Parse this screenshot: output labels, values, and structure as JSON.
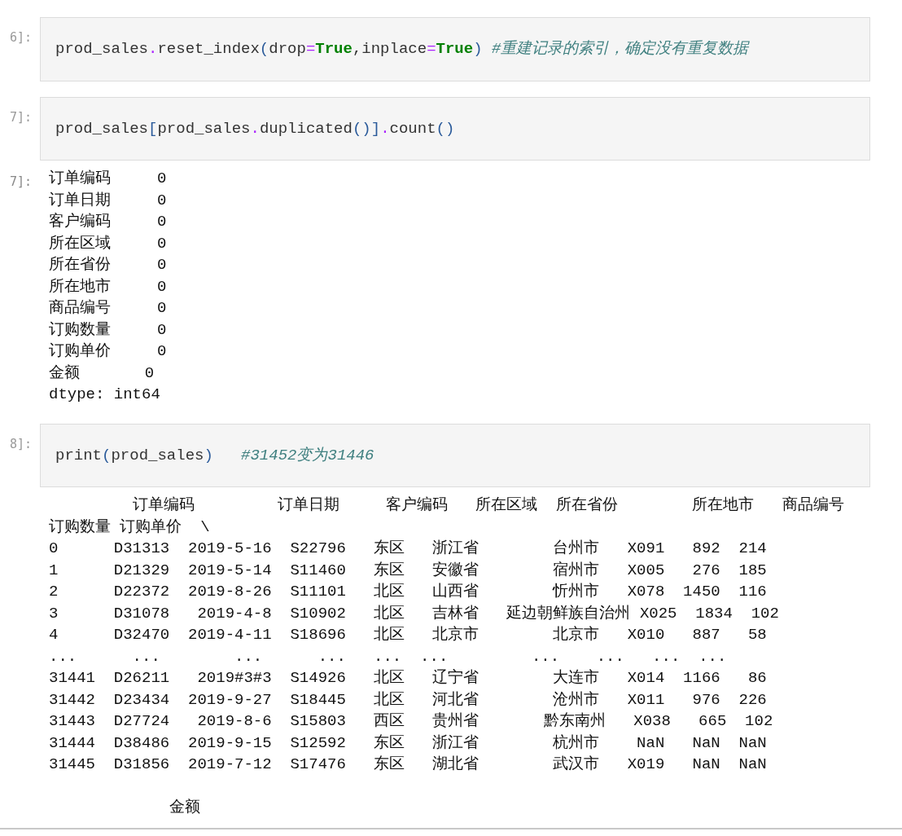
{
  "cells": [
    {
      "prompt": "6]:",
      "code": [
        {
          "kind": "name",
          "text": "prod_sales"
        },
        {
          "kind": "punct",
          "text": "."
        },
        {
          "kind": "name",
          "text": "reset_index"
        },
        {
          "kind": "paren",
          "text": "("
        },
        {
          "kind": "name",
          "text": "drop"
        },
        {
          "kind": "op",
          "text": "="
        },
        {
          "kind": "keyword",
          "text": "True"
        },
        {
          "kind": "name",
          "text": ","
        },
        {
          "kind": "name",
          "text": "inplace"
        },
        {
          "kind": "op",
          "text": "="
        },
        {
          "kind": "keyword",
          "text": "True"
        },
        {
          "kind": "paren",
          "text": ") "
        },
        {
          "kind": "comment",
          "text": "#重建记录的索引，确定没有重复数据"
        }
      ]
    },
    {
      "prompt": "7]:",
      "code": [
        {
          "kind": "name",
          "text": "prod_sales"
        },
        {
          "kind": "paren",
          "text": "["
        },
        {
          "kind": "name",
          "text": "prod_sales"
        },
        {
          "kind": "punct",
          "text": "."
        },
        {
          "kind": "name",
          "text": "duplicated"
        },
        {
          "kind": "paren",
          "text": "()"
        },
        {
          "kind": "paren",
          "text": "]"
        },
        {
          "kind": "punct",
          "text": "."
        },
        {
          "kind": "name",
          "text": "count"
        },
        {
          "kind": "paren",
          "text": "()"
        }
      ],
      "output": {
        "prompt": "7]:",
        "blocks": [
          {
            "lines": [
              "订单编码     0",
              "订单日期     0",
              "客户编码     0",
              "所在区域     0",
              "所在省份     0",
              "所在地市     0",
              "商品编号     0",
              "订购数量     0",
              "订购单价     0",
              "金额       0",
              "dtype: int64"
            ]
          }
        ]
      }
    },
    {
      "prompt": "8]:",
      "code": [
        {
          "kind": "name",
          "text": "print"
        },
        {
          "kind": "paren",
          "text": "("
        },
        {
          "kind": "name",
          "text": "prod_sales"
        },
        {
          "kind": "paren",
          "text": ")   "
        },
        {
          "kind": "comment",
          "text": "#31452变为31446"
        }
      ],
      "output": {
        "blocks": [
          {
            "lines": [
              "         订单编码         订单日期     客户编码   所在区域  所在省份        所在地市   商品编号",
              "订购数量 订购单价  \\",
              "0      D31313  2019-5-16  S22796   东区   浙江省        台州市   X091   892  214",
              "1      D21329  2019-5-14  S11460   东区   安徽省        宿州市   X005   276  185",
              "2      D22372  2019-8-26  S11101   北区   山西省        忻州市   X078  1450  116",
              "3      D31078   2019-4-8  S10902   北区   吉林省   延边朝鲜族自治州 X025  1834  102",
              "4      D32470  2019-4-11  S18696   北区   北京市        北京市   X010   887   58",
              "...      ...        ...      ...   ...  ...         ...    ...   ...  ...",
              "31441  D26211   2019#3#3  S14926   北区   辽宁省        大连市   X014  1166   86",
              "31442  D23434  2019-9-27  S18445   北区   河北省        沧州市   X011   976  226",
              "31443  D27724   2019-8-6  S15803   西区   贵州省       黔东南州   X038   665  102",
              "31444  D38486  2019-9-15  S12592   东区   浙江省        杭州市    NaN   NaN  NaN",
              "31445  D31856  2019-7-12  S17476   东区   湖北省        武汉市   X019   NaN  NaN"
            ]
          },
          {
            "lines": [
              "             金额"
            ]
          }
        ]
      }
    }
  ]
}
